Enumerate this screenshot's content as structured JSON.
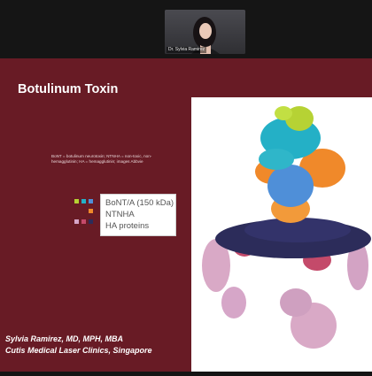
{
  "video": {
    "participant_name": "Dr. Sylvia Ramirez"
  },
  "slide": {
    "title": "Botulinum Toxin",
    "caption": "BoNT = botulinum neurotoxin; NTNHA = non-toxic, non-hemagglutinin; HA = hemagglutinin; images Abbvie",
    "legend": [
      {
        "label": "BoNT/A (150 kDa)",
        "colors": [
          "#b6d234",
          "#24b0c6",
          "#4f8fd8"
        ]
      },
      {
        "label": "NTNHA",
        "colors": [
          "#f0892a"
        ]
      },
      {
        "label": "HA proteins",
        "colors": [
          "#d6a6c8",
          "#c44a6a",
          "#2c2c5a"
        ]
      }
    ],
    "footer_line1": "Sylvia Ramirez, MD, MPH, MBA",
    "footer_line2": "Cutis Medical Laser Clinics, Singapore"
  }
}
